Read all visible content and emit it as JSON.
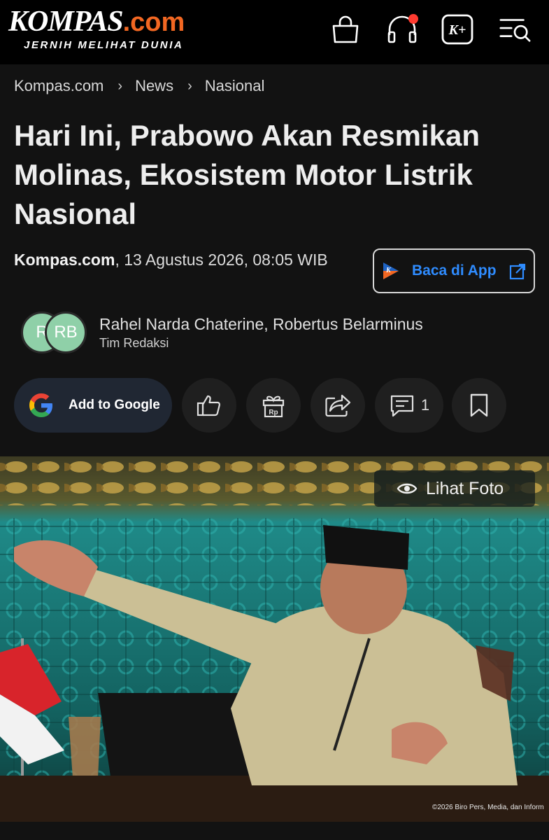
{
  "header": {
    "logo_main": "KOMPAS",
    "logo_suffix": ".com",
    "tagline": "JERNIH MELIHAT DUNIA",
    "icons": [
      "shopping-bag-icon",
      "headphones-icon",
      "kompas-plus-icon",
      "menu-search-icon"
    ],
    "kplus_label": "K+"
  },
  "breadcrumb": {
    "items": [
      "Kompas.com",
      "News",
      "Nasional"
    ],
    "separator": "›"
  },
  "article": {
    "title": "Hari Ini, Prabowo Akan Resmikan Molinas, Ekosistem Motor Listrik Nasional",
    "source": "Kompas.com",
    "date": ", 13 Agustus 2026, 08:05 WIB",
    "app_button": "Baca di App",
    "authors": {
      "avatar_1": "R",
      "avatar_2": "RB",
      "names": "Rahel Narda Chaterine,  Robertus Belarminus",
      "team": "Tim Redaksi"
    }
  },
  "actions": {
    "google_label": "Add to Google",
    "comment_count": "1",
    "icons": [
      "like-icon",
      "gift-rp-icon",
      "share-icon",
      "comment-icon",
      "bookmark-icon"
    ],
    "gift_label": "Rp"
  },
  "photo": {
    "view_label": "Lihat Foto",
    "credit": "©2026 Biro Pers, Media, dan Inform"
  },
  "colors": {
    "brand_orange": "#f26722",
    "link_blue": "#2f8cff",
    "background": "#121212"
  }
}
